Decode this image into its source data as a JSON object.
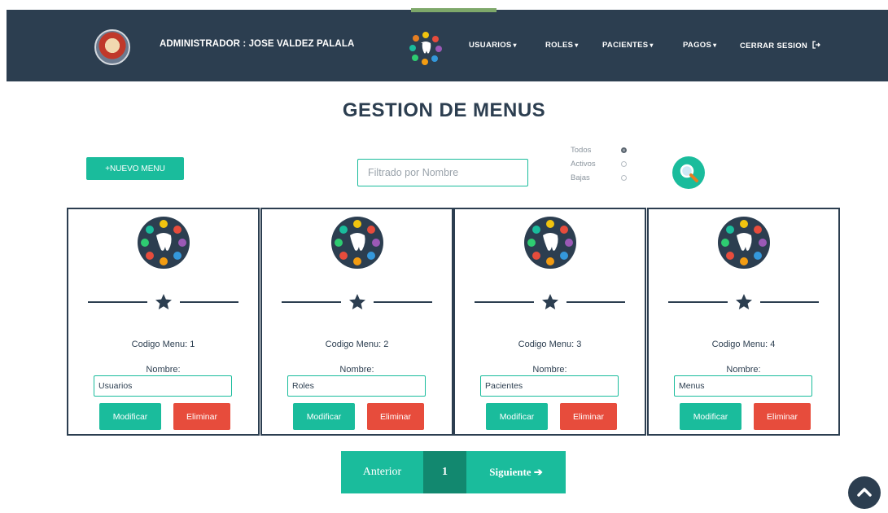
{
  "navbar": {
    "admin_label": "ADMINISTRADOR : JOSE VALDEZ PALALA",
    "links": [
      {
        "label": "USUARIOS",
        "caret": "▾"
      },
      {
        "label": "ROLES",
        "caret": "▾"
      },
      {
        "label": "PACIENTES",
        "caret": "▾"
      },
      {
        "label": "PAGOS",
        "caret": "▾"
      },
      {
        "label": "CERRAR SESION",
        "icon": "sign-out-icon"
      }
    ]
  },
  "page": {
    "title": "GESTION DE MENUS"
  },
  "toolbar": {
    "new_button": "+NUEVO MENU",
    "search_placeholder": "Filtrado por Nombre",
    "filters": [
      {
        "label": "Todos",
        "selected": true
      },
      {
        "label": "Activos",
        "selected": false
      },
      {
        "label": "Bajas",
        "selected": false
      }
    ],
    "search_button_icon": "search-icon"
  },
  "cards": [
    {
      "code_label": "Codigo Menu: 1",
      "name_label": "Nombre:",
      "name_value": "Usuarios",
      "modify_label": "Modificar",
      "delete_label": "Eliminar"
    },
    {
      "code_label": "Codigo Menu: 2",
      "name_label": "Nombre:",
      "name_value": "Roles",
      "modify_label": "Modificar",
      "delete_label": "Eliminar"
    },
    {
      "code_label": "Codigo Menu: 3",
      "name_label": "Nombre:",
      "name_value": "Pacientes",
      "modify_label": "Modificar",
      "delete_label": "Eliminar"
    },
    {
      "code_label": "Codigo Menu: 4",
      "name_label": "Nombre:",
      "name_value": "Menus",
      "modify_label": "Modificar",
      "delete_label": "Eliminar"
    }
  ],
  "pagination": {
    "prev_label": "Anterior",
    "current_page": "1",
    "next_label": "Siguiente ➔"
  },
  "colors": {
    "navbar": "#2c3e50",
    "accent": "#1abc9c",
    "danger": "#e74c3c",
    "page_active": "#12886f"
  }
}
